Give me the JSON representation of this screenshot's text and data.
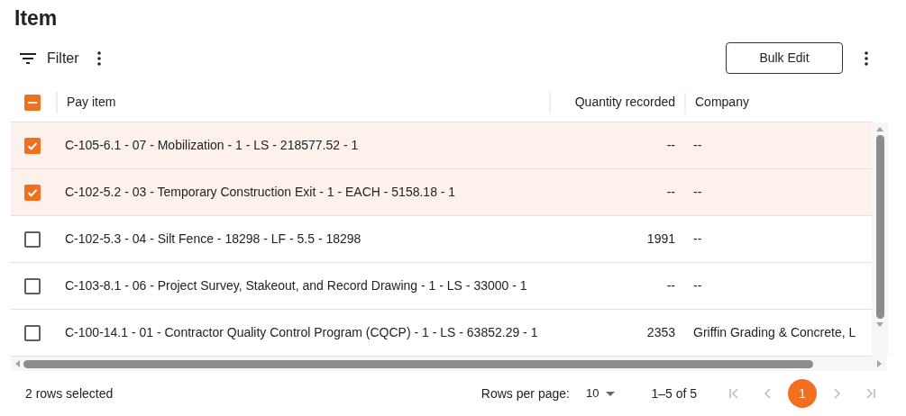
{
  "title": "Item",
  "toolbar": {
    "filter_label": "Filter",
    "bulk_edit_label": "Bulk Edit"
  },
  "table": {
    "select_all": {
      "indeterminate": true
    },
    "columns": [
      "Pay item",
      "Quantity recorded",
      "Company"
    ],
    "rows": [
      {
        "selected": true,
        "cells": [
          "C-105-6.1 - 07 - Mobilization - 1 - LS - 218577.52 - 1",
          "--",
          "--"
        ]
      },
      {
        "selected": true,
        "cells": [
          "C-102-5.2 - 03 - Temporary Construction Exit - 1 - EACH - 5158.18 - 1",
          "--",
          "--"
        ]
      },
      {
        "selected": false,
        "cells": [
          "C-102-5.3 - 04 - Silt Fence - 18298 - LF - 5.5 - 18298",
          "1991",
          "--"
        ]
      },
      {
        "selected": false,
        "cells": [
          "C-103-8.1 - 06 - Project Survey, Stakeout, and Record Drawing - 1 - LS - 33000 - 1",
          "--",
          "--"
        ]
      },
      {
        "selected": false,
        "cells": [
          "C-100-14.1 - 01 - Contractor Quality Control Program (CQCP) - 1 - LS - 63852.29 - 1",
          "2353",
          "Griffin Grading & Concrete, L"
        ]
      }
    ]
  },
  "footer": {
    "selection_count": "2 rows selected",
    "rows_per_page_label": "Rows per page:",
    "rows_per_page": "10",
    "range": "1–5 of 5",
    "nav": [
      {
        "kind": "first",
        "disabled": true
      },
      {
        "kind": "prev",
        "disabled": true
      },
      {
        "kind": "next",
        "disabled": true
      },
      {
        "kind": "last",
        "disabled": true
      }
    ],
    "pages": [
      {
        "label": "1",
        "selected": true
      }
    ]
  }
}
